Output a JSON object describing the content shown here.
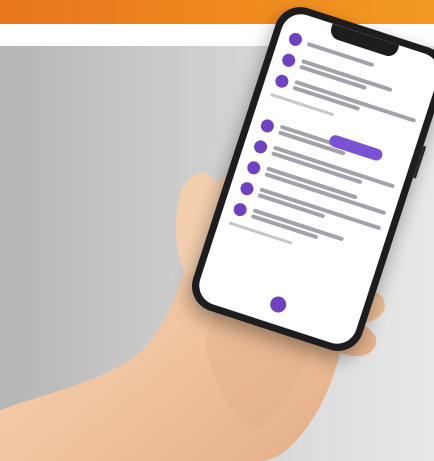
{
  "scene": {
    "description_colors": {
      "top_bar": "#f08b1f",
      "background": "#d3d3d3",
      "app_accent": "#6f42c1",
      "skin": "#f0c9a6"
    }
  }
}
